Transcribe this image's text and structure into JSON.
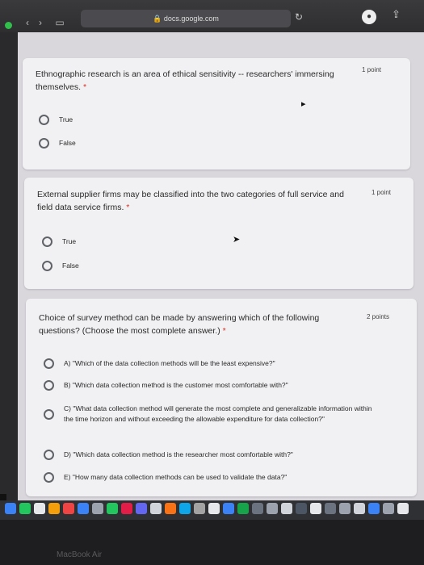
{
  "browser": {
    "url": "docs.google.com"
  },
  "form": {
    "questions": [
      {
        "text": "Ethnographic research is an area of ethical sensitivity -- researchers' immersing themselves.",
        "required_mark": "*",
        "points": "1 point",
        "options": [
          "True",
          "False"
        ]
      },
      {
        "text": "External supplier firms may be classified into the two categories of full service and field data service firms.",
        "required_mark": "*",
        "points": "1 point",
        "options": [
          "True",
          "False"
        ]
      },
      {
        "text": "Choice of survey method can be made by answering which of the following questions? (Choose the most complete answer.)",
        "required_mark": "*",
        "points": "2 points",
        "options": [
          "A) \"Which of the data collection methods will be the least expensive?\"",
          "B) \"Which data collection method is the customer most comfortable with?\"",
          "C) \"What data collection method will generate the most complete and generalizable information within the time horizon and without exceeding the allowable expenditure for data collection?\"",
          "D) \"Which data collection method is the researcher most comfortable with?\"",
          "E) \"How many data collection methods can be used to validate the data?\""
        ]
      }
    ]
  },
  "device": {
    "brand": "MacBook Air"
  }
}
